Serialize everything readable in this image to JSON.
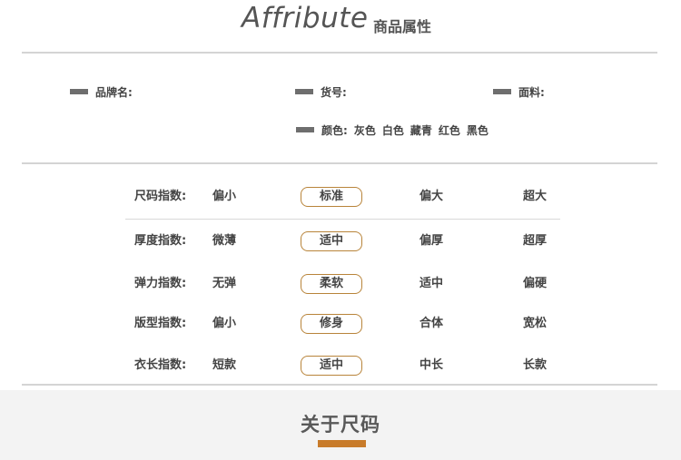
{
  "header": {
    "title_en": "Affribute",
    "separator": "·",
    "title_cn": "商品属性"
  },
  "attributes": {
    "brand_label": "品牌名:",
    "item_no_label": "货号:",
    "fabric_label": "面料:",
    "color_label": "颜色:",
    "colors": [
      "灰色",
      "白色",
      "藏青",
      "红色",
      "黑色"
    ]
  },
  "indices": [
    {
      "label": "尺码指数:",
      "options": [
        "偏小",
        "标准",
        "偏大",
        "超大"
      ],
      "selected": 1
    },
    {
      "label": "厚度指数:",
      "options": [
        "微薄",
        "适中",
        "偏厚",
        "超厚"
      ],
      "selected": 1
    },
    {
      "label": "弹力指数:",
      "options": [
        "无弹",
        "柔软",
        "适中",
        "偏硬"
      ],
      "selected": 1
    },
    {
      "label": "版型指数:",
      "options": [
        "偏小",
        "修身",
        "合体",
        "宽松"
      ],
      "selected": 1
    },
    {
      "label": "衣长指数:",
      "options": [
        "短款",
        "适中",
        "中长",
        "长款"
      ],
      "selected": 1
    }
  ],
  "footer": {
    "title": "关于尺码"
  },
  "colors": {
    "accent": "#c87b2a",
    "pill_border": "#b8843a",
    "marker": "#6e6e6e",
    "footer_bg": "#f3f3f3"
  }
}
